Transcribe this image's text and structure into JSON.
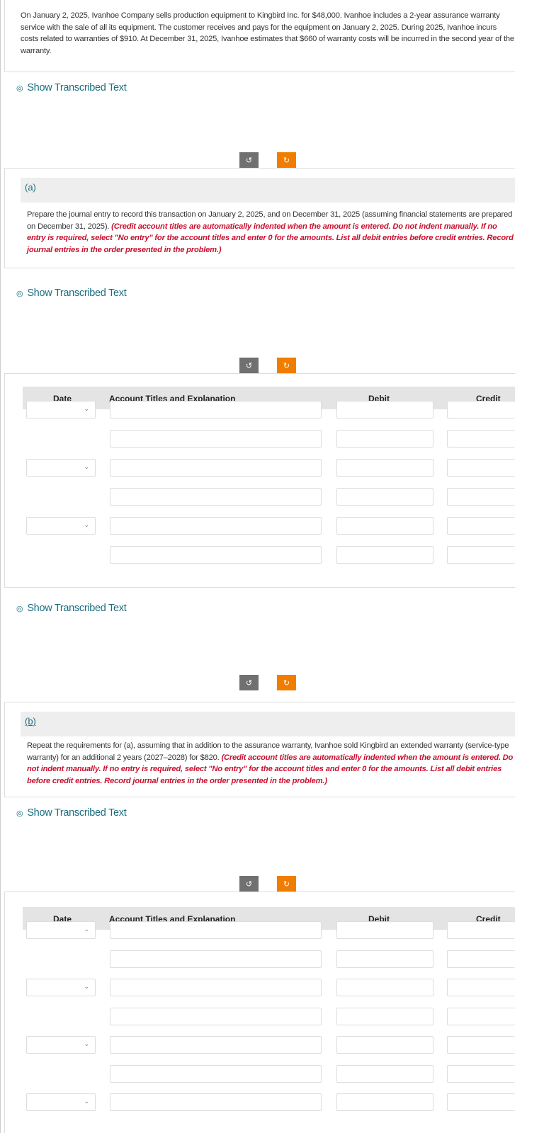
{
  "problem": {
    "text": "On January 2, 2025, Ivanhoe Company sells production equipment to Kingbird Inc. for $48,000. Ivanhoe includes a 2-year assurance warranty service with the sale of all its equipment. The customer receives and pays for the equipment on January 2, 2025. During 2025, Ivanhoe incurs costs related to warranties of $910. At December 31, 2025, Ivanhoe estimates that $660 of warranty costs will be incurred in the second year of the warranty."
  },
  "show_transcribed": "Show Transcribed Text",
  "icons": {
    "eye": "eye-icon",
    "undo": "undo-icon",
    "redo": "redo-icon",
    "chevron": "chevron-down-icon"
  },
  "colors": {
    "accent": "#1a6e80",
    "redo": "#f07d00",
    "undo": "#707070",
    "instruction": "#c8102e"
  },
  "part_a": {
    "label": "(a)",
    "text": "Prepare the journal entry to record this transaction on January 2, 2025, and on December 31, 2025 (assuming financial statements are prepared on December 31, 2025). ",
    "instruction": "(Credit account titles are automatically indented when the amount is entered. Do not indent manually. If no entry is required, select \"No entry\" for the account titles and enter 0 for the amounts. List all debit entries before credit entries. Record journal entries in the order presented in the problem.)"
  },
  "part_b": {
    "label": "(b)",
    "text": "Repeat the requirements for (a), assuming that in addition to the assurance warranty, Ivanhoe sold Kingbird an extended warranty (service-type warranty) for an additional 2 years (2027–2028) for $820. ",
    "instruction": "(Credit account titles are automatically indented when the amount is entered. Do not indent manually. If no entry is required, select \"No entry\" for the account titles and enter 0 for the amounts. List all debit entries before credit entries. Record journal entries in the order presented in the problem.)"
  },
  "table": {
    "headers": {
      "date": "Date",
      "account": "Account Titles and Explanation",
      "debit": "Debit",
      "credit": "Credit"
    }
  }
}
